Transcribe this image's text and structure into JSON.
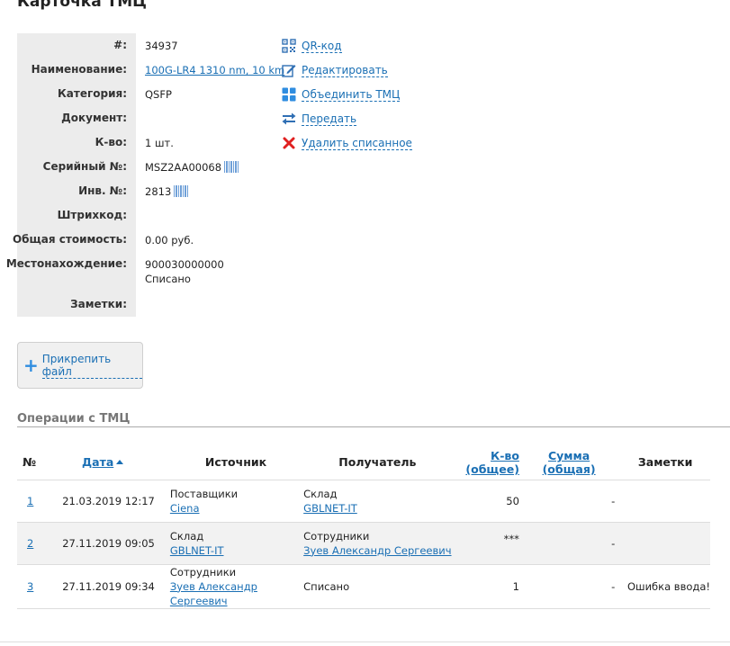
{
  "page": {
    "title": "Карточка ТМЦ"
  },
  "details": [
    {
      "label": "#:",
      "value": "34937"
    },
    {
      "label": "Наименование:",
      "value": "100G-LR4 1310 nm, 10 km"
    },
    {
      "label": "Категория:",
      "value": "QSFP"
    },
    {
      "label": "Документ:",
      "value": ""
    },
    {
      "label": "К-во:",
      "value": "1 шт."
    },
    {
      "label": "Серийный №:",
      "value": "MSZ2AA00068"
    },
    {
      "label": "Инв. №:",
      "value": "2813"
    },
    {
      "label": "Штрихкод:",
      "value": ""
    },
    {
      "label": "Общая стоимость:",
      "value": "0.00 руб."
    },
    {
      "label": "Местонахождение:",
      "value": "900030000000",
      "value2": "Списано"
    },
    {
      "label": "Заметки:",
      "value": ""
    }
  ],
  "actions": {
    "qr": {
      "label": "QR-код",
      "icon": "qr-code-icon"
    },
    "edit": {
      "label": "Редактировать",
      "icon": "edit-icon"
    },
    "merge": {
      "label": "Объединить ТМЦ",
      "icon": "grid-icon"
    },
    "transfer": {
      "label": "Передать",
      "icon": "transfer-arrows-icon"
    },
    "delete": {
      "label": "Удалить списанное",
      "icon": "red-cross-icon"
    }
  },
  "attach": {
    "label": "Прикрепить файл"
  },
  "operations": {
    "title": "Операции с ТМЦ",
    "headers": {
      "num": "№",
      "date": "Дата",
      "source": "Источник",
      "recipient": "Получатель",
      "qty": "К-во (общее)",
      "sum": "Сумма (общая)",
      "notes": "Заметки"
    },
    "rows": [
      {
        "num": "1",
        "date": "21.03.2019 12:17",
        "source_type": "Поставщики",
        "source_name": "Ciena",
        "dest_type": "Склад",
        "dest_name": "GBLNET-IT",
        "qty": "50",
        "sum": "-",
        "note": ""
      },
      {
        "num": "2",
        "date": "27.11.2019 09:05",
        "source_type": "Склад",
        "source_name": "GBLNET-IT",
        "dest_type": "Сотрудники",
        "dest_name": "Зуев Александр Сергеевич",
        "qty": "***",
        "sum": "-",
        "note": ""
      },
      {
        "num": "3",
        "date": "27.11.2019 09:34",
        "source_type": "Сотрудники",
        "source_name": "Зуев Александр Сергеевич",
        "dest_type": "Списано",
        "dest_name": "",
        "qty": "1",
        "sum": "-",
        "note": "Ошибка ввода!"
      }
    ]
  },
  "colors": {
    "link": "#1a6fb4",
    "label_bg": "#ececec",
    "delete": "#e02020",
    "accent": "#2f8de0"
  }
}
